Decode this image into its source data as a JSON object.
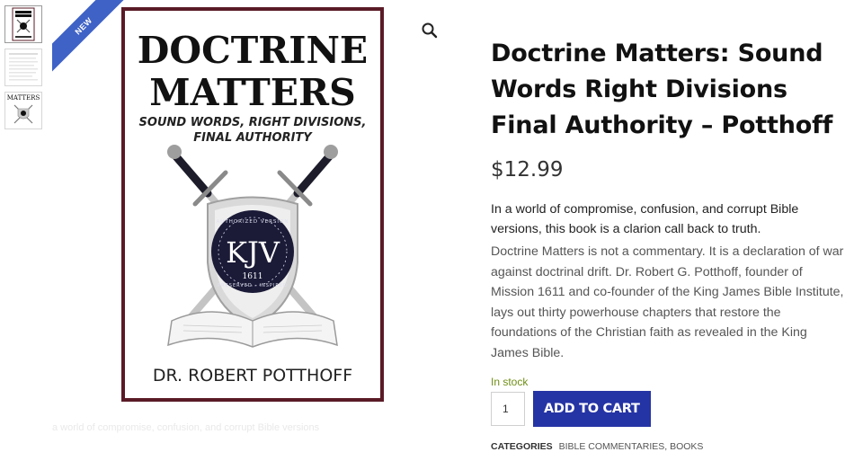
{
  "badge": {
    "new_label": "NEW"
  },
  "cover": {
    "title_line1": "DOCTRINE",
    "title_line2": "MATTERS",
    "subtitle_line1": "SOUND WORDS, RIGHT DIVISIONS,",
    "subtitle_line2": "FINAL AUTHORITY",
    "seal_top": "AUTHORIZED VERSION",
    "seal_bottom": "PRESERVED · INSPIRED",
    "seal_center": "KJV",
    "seal_year": "1611",
    "author": "DR. ROBERT POTTHOFF"
  },
  "thumb_title": "MATTERS",
  "product": {
    "title": "Doctrine Matters: Sound Words Right Divisions Final Authority – Potthoff",
    "price": "$12.99",
    "lead": "In a world of compromise, confusion, and corrupt Bible versions, this book is a clarion call back to truth.",
    "description": "Doctrine Matters is not a commentary. It is a declaration of war against doctrinal drift. Dr. Robert G. Potthoff, founder of Mission 1611 and co-founder of the King James Bible Institute, lays out thirty powerhouse chapters that restore the foundations of the Christian faith as revealed in the King James Bible.",
    "stock": "In stock",
    "quantity": "1",
    "add_to_cart": "ADD TO CART",
    "categories_label": "CATEGORIES",
    "categories": [
      "BIBLE COMMENTARIES",
      "BOOKS"
    ],
    "category_separator": ", "
  },
  "ghost_text": "a world of compromise, confusion, and corrupt Bible versions",
  "colors": {
    "accent": "#2534a4",
    "ribbon": "#3f62c6",
    "cover_border": "#5a1b26",
    "stock": "#6f8e15"
  }
}
